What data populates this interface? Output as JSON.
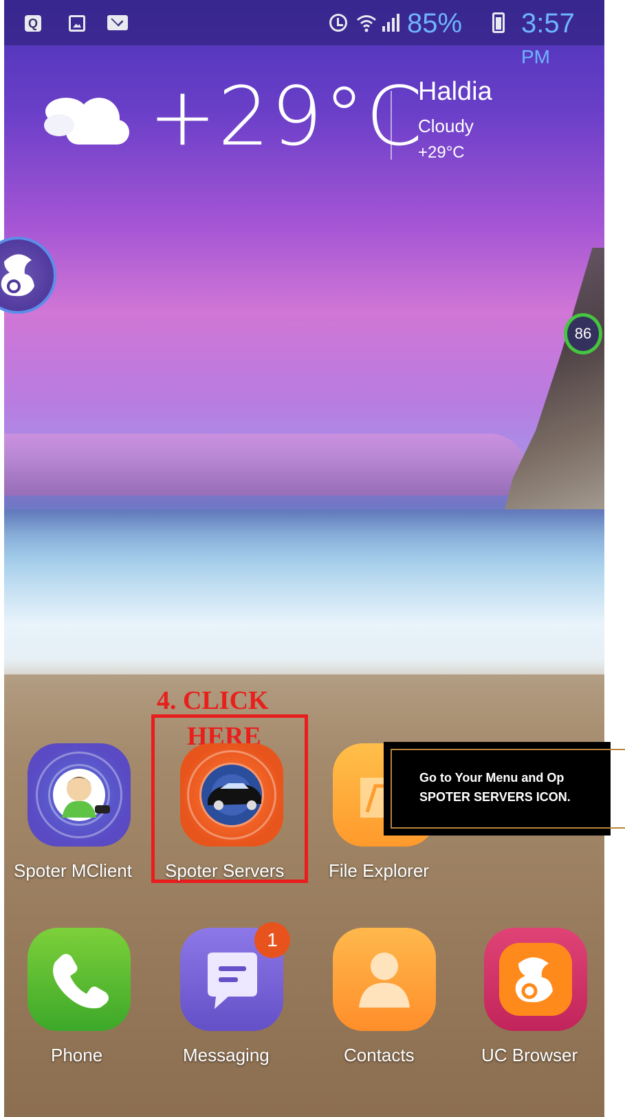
{
  "status_bar": {
    "battery_percent": "85%",
    "time": "3:57",
    "ampm": "PM",
    "q_icon_letter": "Q"
  },
  "weather": {
    "temperature": "+29°C",
    "city": "Haldia",
    "condition": "Cloudy",
    "sub_temperature": "+29°C"
  },
  "floating": {
    "ram_percent": "86"
  },
  "annotation": {
    "click_label_line1": "4.  CLICK",
    "click_label_line2": "HERE",
    "note_line1": "Go to Your Menu  and Op",
    "note_line2": "SPOTER SERVERS ICON."
  },
  "apps": {
    "row1": [
      {
        "label": "Spoter MClient",
        "icon": "person-avatar-icon"
      },
      {
        "label": "Spoter Servers",
        "icon": "car-radar-icon"
      },
      {
        "label": "File Explorer",
        "icon": "folder-icon"
      }
    ],
    "dock": [
      {
        "label": "Phone",
        "icon": "phone-icon"
      },
      {
        "label": "Messaging",
        "icon": "message-bubble-icon",
        "badge": "1"
      },
      {
        "label": "Contacts",
        "icon": "person-icon"
      },
      {
        "label": "UC Browser",
        "icon": "squirrel-icon"
      }
    ]
  },
  "colors": {
    "status_text": "#6fb4ff",
    "annotation_red": "#e8201c",
    "badge_orange": "#e8521c"
  }
}
